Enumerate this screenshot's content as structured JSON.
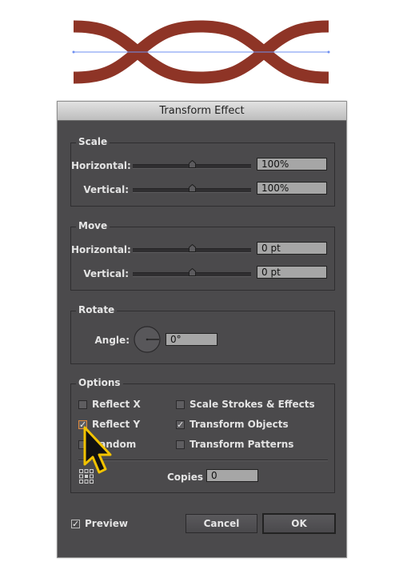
{
  "artwork": {
    "description": "wavy-ribbon-shape",
    "stroke_color": "#8e3426",
    "guide_color": "#6e8ff0"
  },
  "dialog": {
    "title": "Transform Effect",
    "scale": {
      "title": "Scale",
      "horizontal": {
        "label": "Horizontal:",
        "value": "100%",
        "slider_fraction": 0.5
      },
      "vertical": {
        "label": "Vertical:",
        "value": "100%",
        "slider_fraction": 0.5
      }
    },
    "move": {
      "title": "Move",
      "horizontal": {
        "label": "Horizontal:",
        "value": "0 pt",
        "slider_fraction": 0.5
      },
      "vertical": {
        "label": "Vertical:",
        "value": "0 pt",
        "slider_fraction": 0.5
      }
    },
    "rotate": {
      "title": "Rotate",
      "angle_label": "Angle:",
      "angle_value": "0°"
    },
    "options": {
      "title": "Options",
      "reflect_x": {
        "label": "Reflect X",
        "checked": false
      },
      "reflect_y": {
        "label": "Reflect Y",
        "checked": true
      },
      "random": {
        "label": "Random",
        "checked": false
      },
      "scale_strokes": {
        "label": "Scale Strokes & Effects",
        "checked": false
      },
      "transform_objects": {
        "label": "Transform Objects",
        "checked": true
      },
      "transform_patterns": {
        "label": "Transform Patterns",
        "checked": false
      },
      "copies_label": "Copies",
      "copies_value": "0"
    },
    "preview": {
      "label": "Preview",
      "checked": true
    },
    "cancel_label": "Cancel",
    "ok_label": "OK",
    "check_glyph": "✓"
  }
}
